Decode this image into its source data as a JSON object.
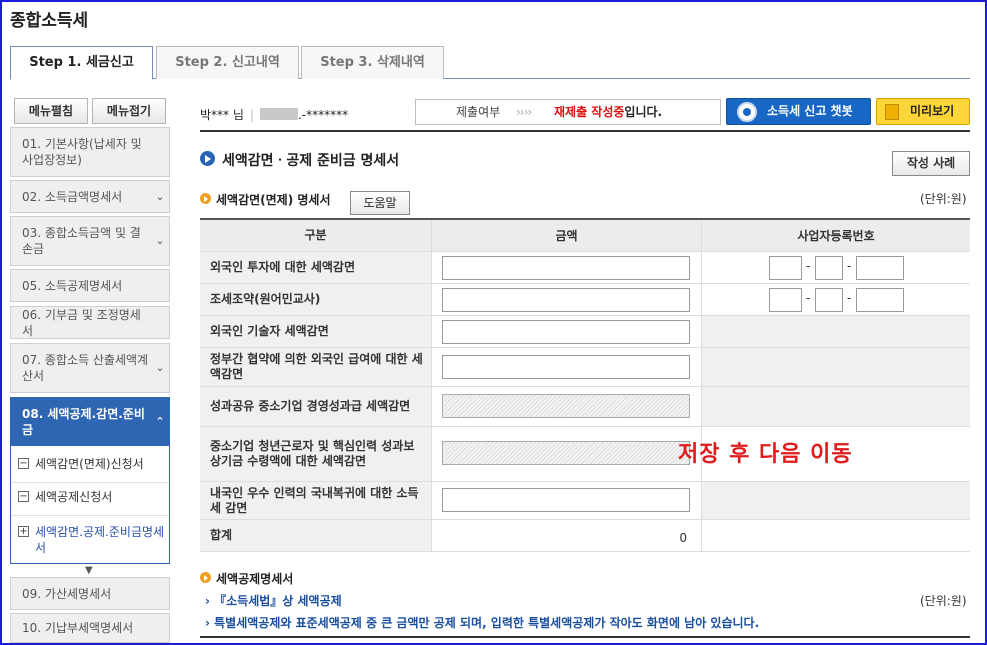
{
  "page_title": "종합소득세",
  "tabs": [
    {
      "label": "Step 1. 세금신고",
      "active": true
    },
    {
      "label": "Step 2. 신고내역",
      "active": false
    },
    {
      "label": "Step 3. 삭제내역",
      "active": false
    }
  ],
  "sidebar": {
    "expand_all": "메뉴펼침",
    "collapse_all": "메뉴접기",
    "items": [
      {
        "label": "01. 기본사항(납세자 및 사업장정보)"
      },
      {
        "label": "02. 소득금액명세서"
      },
      {
        "label": "03. 종합소득금액 및 결손금"
      },
      {
        "label": "05. 소득공제명세서"
      },
      {
        "label": "06. 기부금 및 조정명세서"
      },
      {
        "label": "07. 종합소득 산출세액계산서"
      },
      {
        "label": "08. 세액공제.감면.준비금"
      },
      {
        "label": "09. 가산세명세서"
      },
      {
        "label": "10. 기납부세액명세서"
      }
    ],
    "sub_items": [
      {
        "label": "세액감면(면제)신청서"
      },
      {
        "label": "세액공제신청서"
      },
      {
        "label": "세액감면.공제.준비금명세서"
      }
    ]
  },
  "user": {
    "name": "박*** 님",
    "masked_id": ".-*******"
  },
  "status": {
    "label": "제출여부",
    "arrows": "››››",
    "value_red": "재제출 작성중",
    "value_suffix": "입니다."
  },
  "chatbot_button": "소득세 신고 챗봇",
  "preview_button": "미리보기",
  "section": {
    "title": "세액감면ㆍ공제 준비금 명세서",
    "example_button": "작성 사례"
  },
  "reduction": {
    "title": "세액감면(면제) 명세서",
    "help_button": "도움말",
    "unit": "(단위:원)",
    "headers": [
      "구분",
      "금액",
      "사업자등록번호"
    ],
    "rows": [
      {
        "label": "외국인 투자에 대한 세액감면"
      },
      {
        "label": "조세조약(원어민교사)"
      },
      {
        "label": "외국인 기술자 세액감면"
      },
      {
        "label": "정부간 협약에 의한 외국인 급여에 대한 세액감면"
      },
      {
        "label": "성과공유 중소기업 경영성과급 세액감면"
      },
      {
        "label": "중소기업 청년근로자 및 핵심인력 성과보상기금 수령액에 대한 세액감면"
      },
      {
        "label": "내국인 우수 인력의 국내복귀에 대한 소득세 감면"
      }
    ],
    "total_label": "합계",
    "total_value": "0",
    "dash": "-"
  },
  "overlay_note": "저장 후 다음 이동",
  "credit": {
    "title": "세액공제명세서",
    "link1": "› 『소득세법』상 세액공제",
    "unit": "(단위:원)",
    "note": "› 특별세액공제와 표준세액공제 중 큰 금액만 공제 되며, 입력한 특별세액공제가 작아도 화면에 남아 있습니다."
  },
  "colors": {
    "frame_border": "#1b1bd8",
    "sidebar_active": "#2f66b3",
    "chatbot_button": "#1967c4",
    "preview_button": "#ffd63a",
    "overlay_text": "#e01b1b"
  }
}
